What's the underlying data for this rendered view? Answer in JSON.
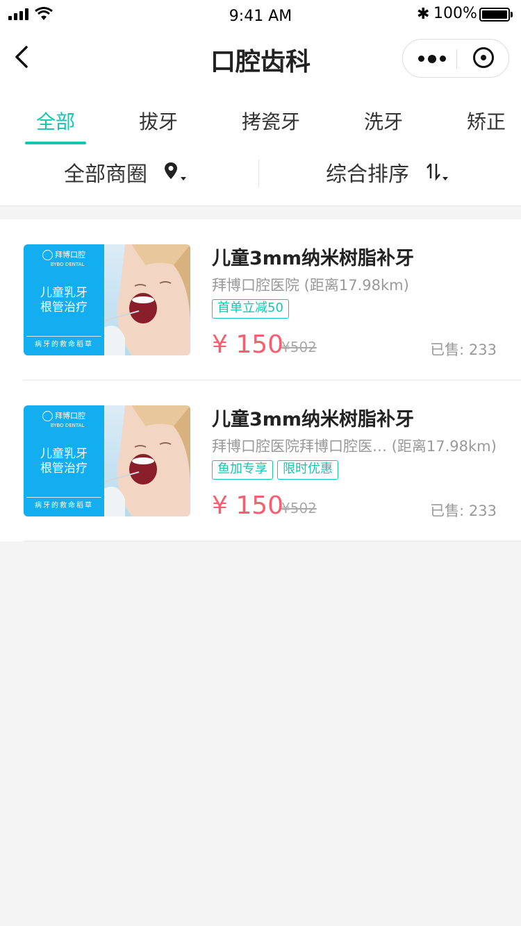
{
  "status_bar": {
    "time": "9:41 AM",
    "battery": "100%"
  },
  "nav": {
    "title": "口腔齿科"
  },
  "tabs": [
    {
      "label": "全部",
      "active": true
    },
    {
      "label": "拔牙"
    },
    {
      "label": "拷瓷牙"
    },
    {
      "label": "洗牙"
    },
    {
      "label": "矫正"
    }
  ],
  "filters": {
    "area": "全部商圈",
    "sort": "综合排序"
  },
  "products": [
    {
      "name": "儿童3mm纳米树脂补牙",
      "shop": "拜博口腔医院 (距离17.98km)",
      "tags": [
        "首单立减50"
      ],
      "price": "¥ 150",
      "original_price": "¥502",
      "sold": "已售: 233",
      "image": {
        "brand": "拜博口腔",
        "brand_en": "BYBO DENTAL",
        "line1": "儿童乳牙",
        "line2": "根管治疗",
        "slogan": "病牙的救命稻草"
      }
    },
    {
      "name": "儿童3mm纳米树脂补牙",
      "shop": "拜博口腔医院拜博口腔医… (距离17.98km)",
      "tags": [
        "鱼加专享",
        "限时优惠"
      ],
      "price": "¥ 150",
      "original_price": "¥502",
      "sold": "已售: 233",
      "image": {
        "brand": "拜博口腔",
        "brand_en": "BYBO DENTAL",
        "line1": "儿童乳牙",
        "line2": "根管治疗",
        "slogan": "病牙的救命稻草"
      }
    }
  ],
  "colors": {
    "accent": "#16c5b1",
    "price": "#f55f6f",
    "thumb_blue": "#12aef0"
  }
}
